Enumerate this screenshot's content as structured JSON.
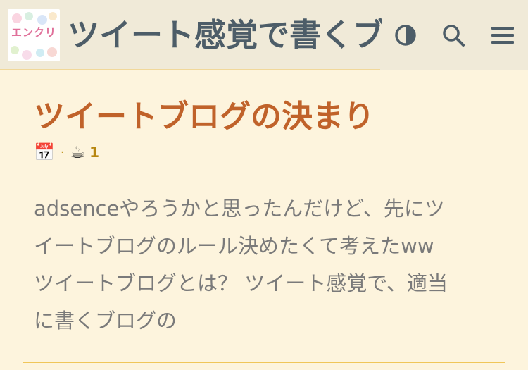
{
  "header": {
    "logo_text": "エンクリ",
    "site_title": "ツイート感覚で書くブログ",
    "icons": [
      "theme-toggle-icon",
      "search-icon",
      "menu-icon"
    ]
  },
  "post": {
    "title": "ツイートブログの決まり",
    "meta": {
      "date_icon": "📅",
      "separator": "·",
      "coffee_icon": "☕",
      "read_time": "1"
    },
    "excerpt_lines": [
      "adsenceやろうかと思ったんだけど、先にツ",
      "イートブログのルール決めたくて考えたww",
      "ツイートブログとは？ ツイート感覚で、適当",
      "に書くブログの"
    ]
  },
  "colors": {
    "background": "#fdf4dd",
    "header_bg": "#f0ead8",
    "title": "#c0622a",
    "accent_line": "#f0c659",
    "header_text": "#4d5d68"
  }
}
